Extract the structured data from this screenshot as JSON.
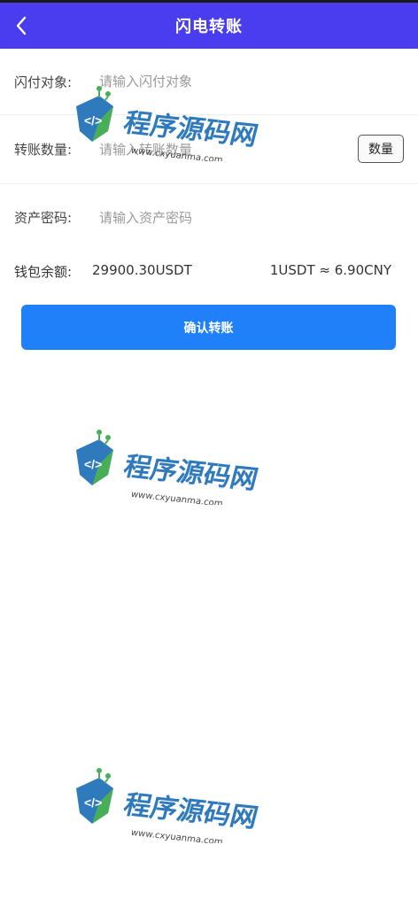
{
  "header": {
    "title": "闪电转账",
    "back_icon": "chevron-left-icon"
  },
  "form": {
    "recipient": {
      "label": "闪付对象:",
      "placeholder": "请输入闪付对象",
      "value": ""
    },
    "amount": {
      "label": "转账数量:",
      "placeholder": "请输入转账数量",
      "value": "",
      "button_label": "数量"
    },
    "password": {
      "label": "资产密码:",
      "placeholder": "请输入资产密码",
      "value": ""
    }
  },
  "wallet": {
    "balance_label": "钱包余额:",
    "balance_value": "29900.30USDT",
    "exchange_rate": "1USDT ≈ 6.90CNY"
  },
  "actions": {
    "confirm_label": "确认转账"
  },
  "watermark": {
    "brand_text": "程序源码网",
    "site_text": "www.cxyuanma.com"
  },
  "colors": {
    "header_bg": "#4a3df0",
    "primary_button": "#1f80fa",
    "text": "#333333",
    "placeholder": "#9a9a9a"
  }
}
